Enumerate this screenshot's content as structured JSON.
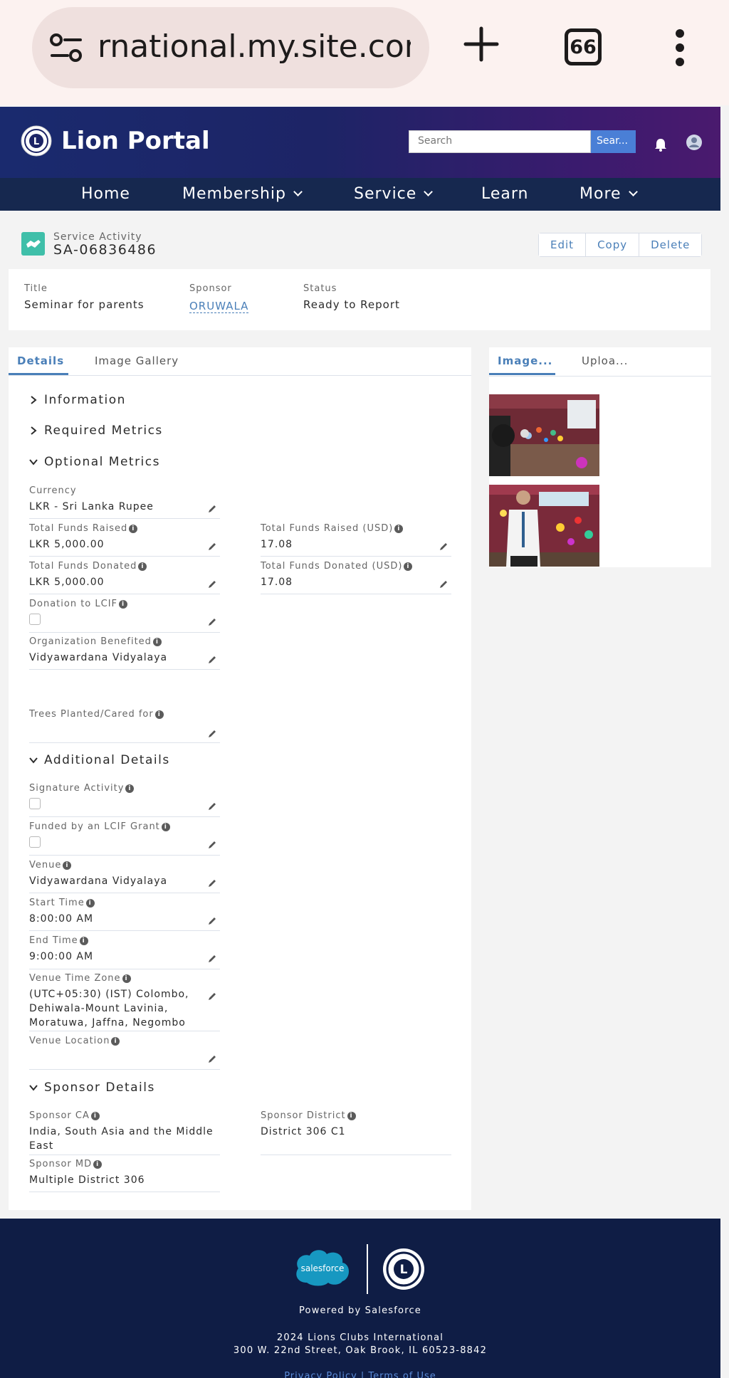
{
  "browser": {
    "url": "rnational.my.site.com",
    "tab_count": "66"
  },
  "header": {
    "portal_title": "Lion Portal",
    "search_placeholder": "Search",
    "search_button": "Sear..."
  },
  "nav": {
    "items": [
      {
        "label": "Home"
      },
      {
        "label": "Membership"
      },
      {
        "label": "Service"
      },
      {
        "label": "Learn"
      },
      {
        "label": "More"
      }
    ]
  },
  "record": {
    "type": "Service Activity",
    "name": "SA-06836486",
    "actions": [
      "Edit",
      "Copy",
      "Delete"
    ],
    "highlights": {
      "title_label": "Title",
      "title_value": "Seminar for parents",
      "sponsor_label": "Sponsor",
      "sponsor_value": "ORUWALA",
      "status_label": "Status",
      "status_value": "Ready to Report"
    }
  },
  "tabs": {
    "details": "Details",
    "gallery": "Image Gallery"
  },
  "sections": {
    "information": "Information",
    "required": "Required Metrics",
    "optional": "Optional Metrics",
    "additional": "Additional Details",
    "sponsor": "Sponsor Details"
  },
  "optional_fields": {
    "currency_label": "Currency",
    "currency_value": "LKR - Sri Lanka Rupee",
    "funds_raised_label": "Total Funds Raised",
    "funds_raised_value": "LKR 5,000.00",
    "funds_raised_usd_label": "Total Funds Raised (USD)",
    "funds_raised_usd_value": "17.08",
    "funds_donated_label": "Total Funds Donated",
    "funds_donated_value": "LKR 5,000.00",
    "funds_donated_usd_label": "Total Funds Donated (USD)",
    "funds_donated_usd_value": "17.08",
    "lcif_label": "Donation to LCIF",
    "org_label": "Organization Benefited",
    "org_value": "Vidyawardana Vidyalaya",
    "trees_label": "Trees Planted/Cared for"
  },
  "additional_fields": {
    "signature_label": "Signature Activity",
    "lcif_grant_label": "Funded by an LCIF Grant",
    "venue_label": "Venue",
    "venue_value": "Vidyawardana Vidyalaya",
    "start_label": "Start Time",
    "start_value": "8:00:00 AM",
    "end_label": "End Time",
    "end_value": "9:00:00 AM",
    "tz_label": "Venue Time Zone",
    "tz_value": "(UTC+05:30) (IST) Colombo, Dehiwala-Mount Lavinia, Moratuwa, Jaffna, Negombo",
    "location_label": "Venue Location"
  },
  "sponsor_fields": {
    "ca_label": "Sponsor CA",
    "ca_value": "India, South Asia and the Middle East",
    "district_label": "Sponsor District",
    "district_value": "District 306 C1",
    "md_label": "Sponsor MD",
    "md_value": "Multiple District 306"
  },
  "side": {
    "tab_images": "Image...",
    "tab_upload": "Uploa..."
  },
  "footer": {
    "salesforce_logo": "salesforce",
    "powered": "Powered by Salesforce",
    "copyright": "2024 Lions Clubs International",
    "address": "300 W. 22nd Street, Oak Brook, IL 60523-8842",
    "links": "Privacy Policy | Terms of Use"
  },
  "colors": {
    "accent": "#4a7fb8",
    "nav_bg": "#16284f",
    "footer_bg": "#0f1d45",
    "record_icon": "#3fbfa9"
  }
}
